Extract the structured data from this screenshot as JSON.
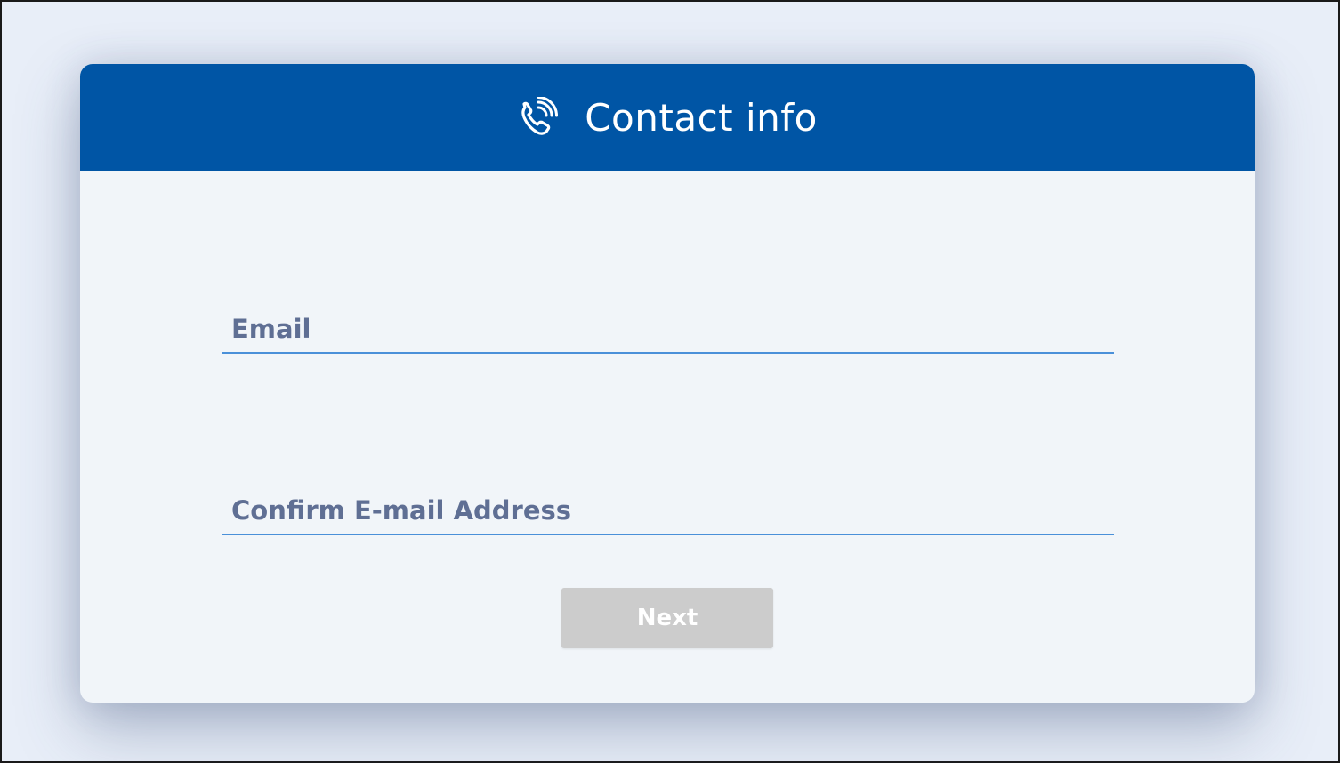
{
  "header": {
    "title": "Contact info",
    "icon": "phone-ringing-icon",
    "background_color": "#0055a5"
  },
  "form": {
    "email": {
      "placeholder": "Email",
      "value": ""
    },
    "confirm_email": {
      "placeholder": "Confirm E-mail Address",
      "value": ""
    },
    "next_button": {
      "label": "Next",
      "disabled": true
    }
  },
  "colors": {
    "accent_underline": "#4a90d9",
    "placeholder_text": "#5f6f94",
    "disabled_button": "#cccccc"
  }
}
